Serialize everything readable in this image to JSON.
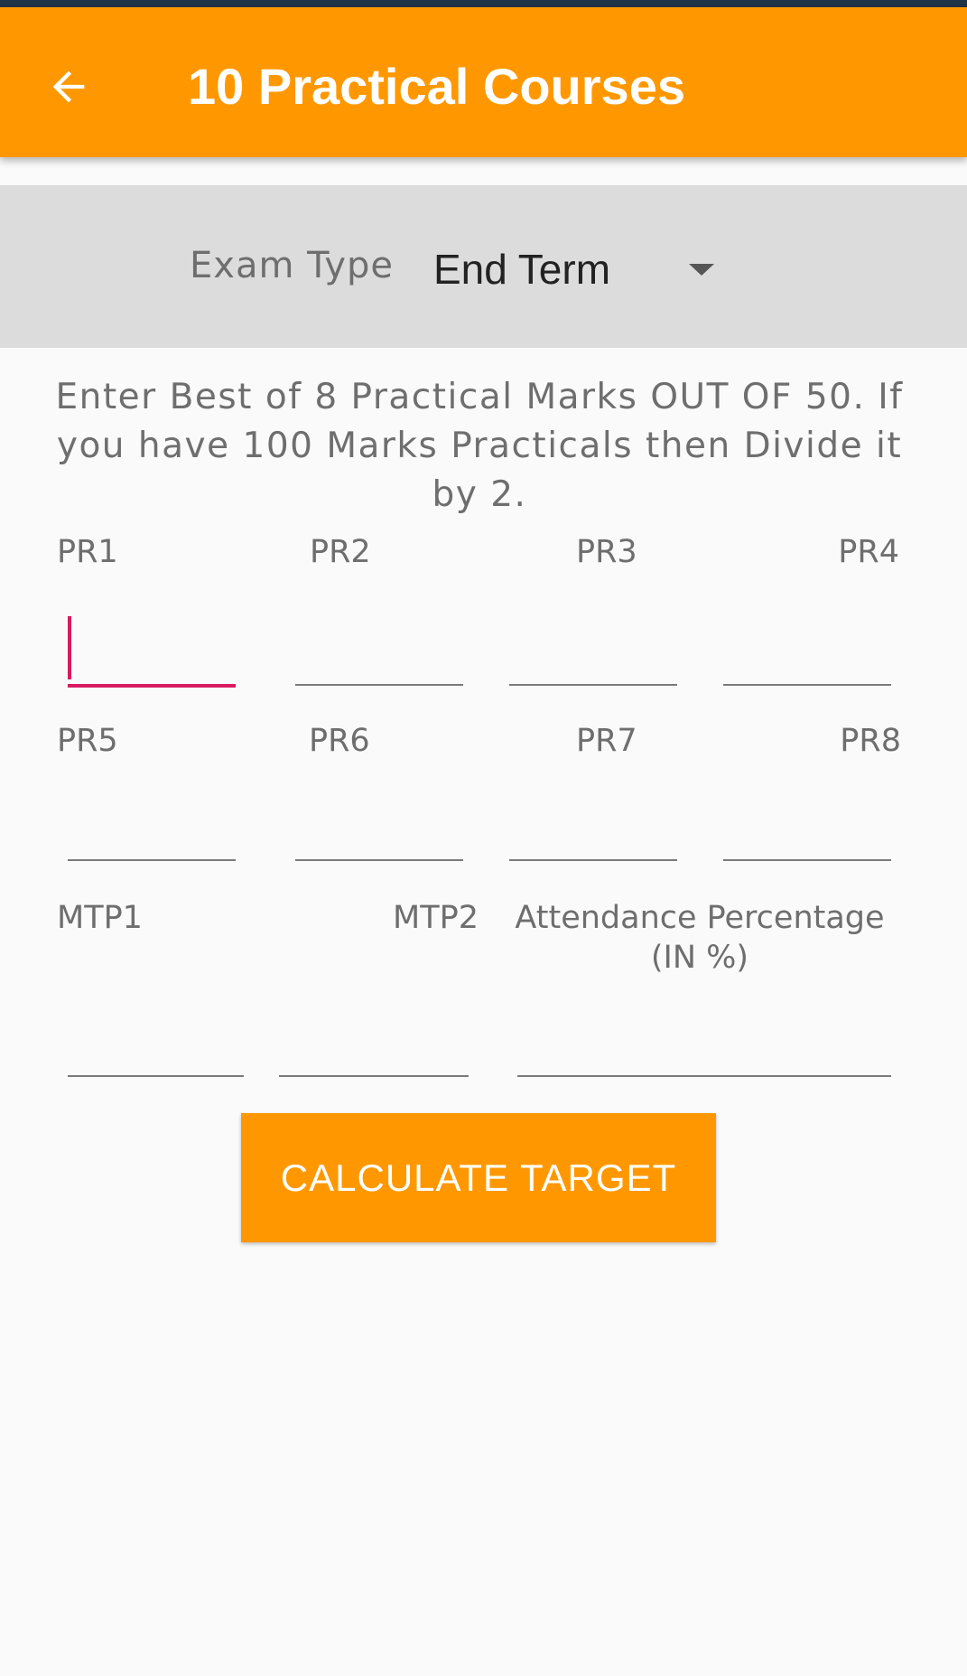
{
  "app_bar": {
    "title": "10 Practical Courses",
    "back_icon": "arrow-back-icon",
    "color": "#ff9800"
  },
  "exam_type": {
    "label": "Exam Type",
    "selected": "End Term",
    "dropdown_icon": "caret-down-icon"
  },
  "instruction": "Enter Best of 8 Practical Marks OUT OF 50. If you have  100 Marks Practicals then Divide it by 2.",
  "fields": {
    "pr1": {
      "label": "PR1",
      "value": ""
    },
    "pr2": {
      "label": "PR2",
      "value": ""
    },
    "pr3": {
      "label": "PR3",
      "value": ""
    },
    "pr4": {
      "label": "PR4",
      "value": ""
    },
    "pr5": {
      "label": "PR5",
      "value": ""
    },
    "pr6": {
      "label": "PR6",
      "value": ""
    },
    "pr7": {
      "label": "PR7",
      "value": ""
    },
    "pr8": {
      "label": "PR8",
      "value": ""
    },
    "mtp1": {
      "label": "MTP1",
      "value": ""
    },
    "mtp2": {
      "label": "MTP2",
      "value": ""
    },
    "attendance": {
      "label": "Attendance Percentage (IN %)",
      "value": ""
    }
  },
  "focused_field": "pr1",
  "accent_color": "#d81b60",
  "calculate_button": {
    "label": "CALCULATE TARGET"
  }
}
